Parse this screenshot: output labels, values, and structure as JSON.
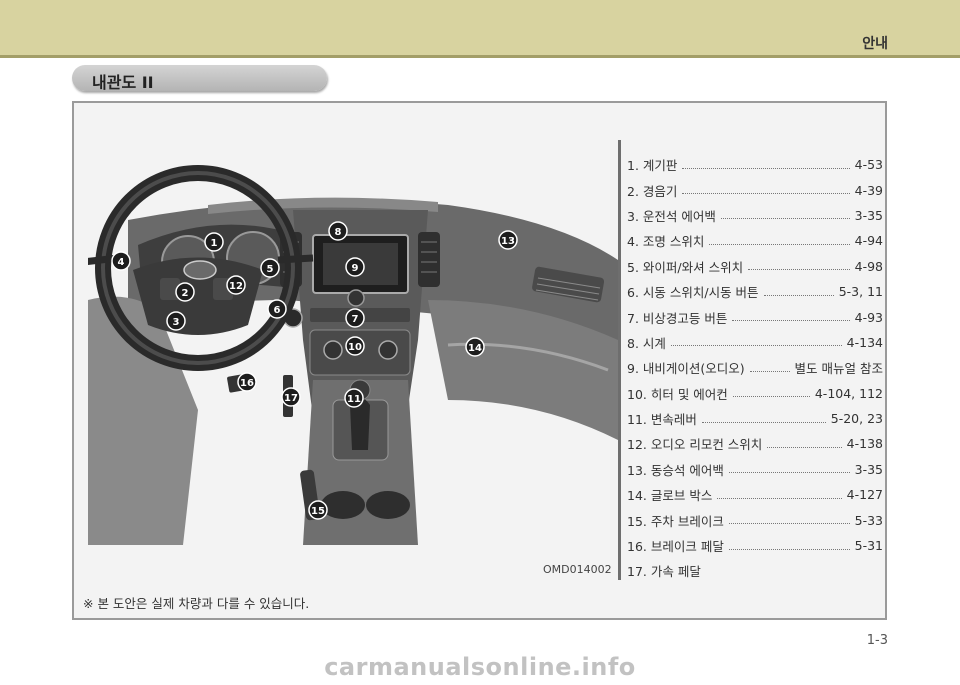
{
  "header": {
    "section": "안내"
  },
  "title": "내관도 II",
  "image_code": "OMD014002",
  "note": "※ 본 도안은 실제 차량과 다를 수 있습니다.",
  "legend": [
    {
      "label": "1. 계기판",
      "page": "4-53"
    },
    {
      "label": "2. 경음기",
      "page": "4-39"
    },
    {
      "label": "3. 운전석 에어백",
      "page": "3-35"
    },
    {
      "label": "4. 조명 스위치",
      "page": "4-94"
    },
    {
      "label": "5. 와이퍼/와셔 스위치",
      "page": "4-98"
    },
    {
      "label": "6. 시동 스위치/시동 버튼",
      "page": "5-3, 11"
    },
    {
      "label": "7. 비상경고등 버튼",
      "page": "4-93"
    },
    {
      "label": "8. 시계",
      "page": "4-134"
    },
    {
      "label": "9. 내비게이션(오디오)",
      "page": "별도 매뉴얼 참조"
    },
    {
      "label": "10. 히터 및 에어컨",
      "page": "4-104, 112"
    },
    {
      "label": "11. 변속레버",
      "page": "5-20, 23"
    },
    {
      "label": "12. 오디오 리모컨 스위치",
      "page": "4-138"
    },
    {
      "label": "13. 동승석 에어백",
      "page": "3-35"
    },
    {
      "label": "14. 글로브 박스",
      "page": "4-127"
    },
    {
      "label": "15. 주차 브레이크",
      "page": "5-33"
    },
    {
      "label": "16. 브레이크 페달",
      "page": "5-31"
    },
    {
      "label": "17. 가속 페달",
      "page": ""
    }
  ],
  "callouts": [
    "1",
    "2",
    "3",
    "4",
    "5",
    "6",
    "7",
    "8",
    "9",
    "10",
    "11",
    "12",
    "13",
    "14",
    "15",
    "16",
    "17"
  ],
  "page_number": "1-3",
  "watermark": "carmanualsonline.info"
}
